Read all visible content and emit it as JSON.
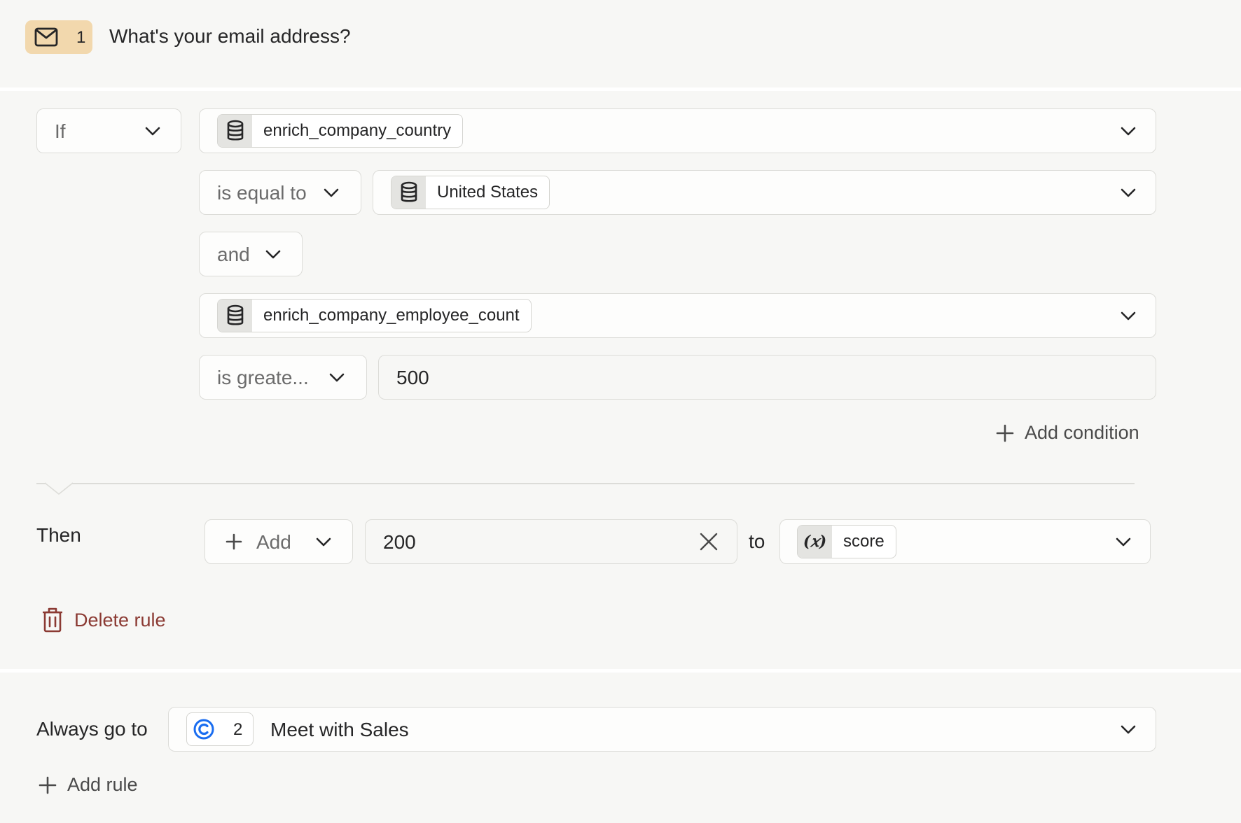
{
  "question": {
    "number": "1",
    "title": "What's your email address?",
    "icon": "mail-icon"
  },
  "rule": {
    "if_label": "If",
    "conditions": [
      {
        "field": "enrich_company_country",
        "field_icon": "database-icon"
      },
      {
        "operator": "is equal to",
        "value": "United States",
        "value_icon": "database-icon"
      },
      {
        "joiner": "and"
      },
      {
        "field": "enrich_company_employee_count",
        "field_icon": "database-icon"
      },
      {
        "operator": "is greate...",
        "value": "500"
      }
    ],
    "add_condition_label": "Add condition",
    "then_label": "Then",
    "action": {
      "verb": "Add",
      "amount": "200",
      "to_label": "to",
      "target": "score",
      "target_icon": "variable-icon"
    },
    "delete_label": "Delete rule"
  },
  "fallback": {
    "label": "Always go to",
    "destination_number": "2",
    "destination": "Meet with Sales",
    "destination_icon": "calendly-icon"
  },
  "add_rule_label": "Add rule",
  "colors": {
    "badge": "#f2d8ad",
    "delete": "#8b3a33",
    "accent_blue": "#1a6df0"
  }
}
